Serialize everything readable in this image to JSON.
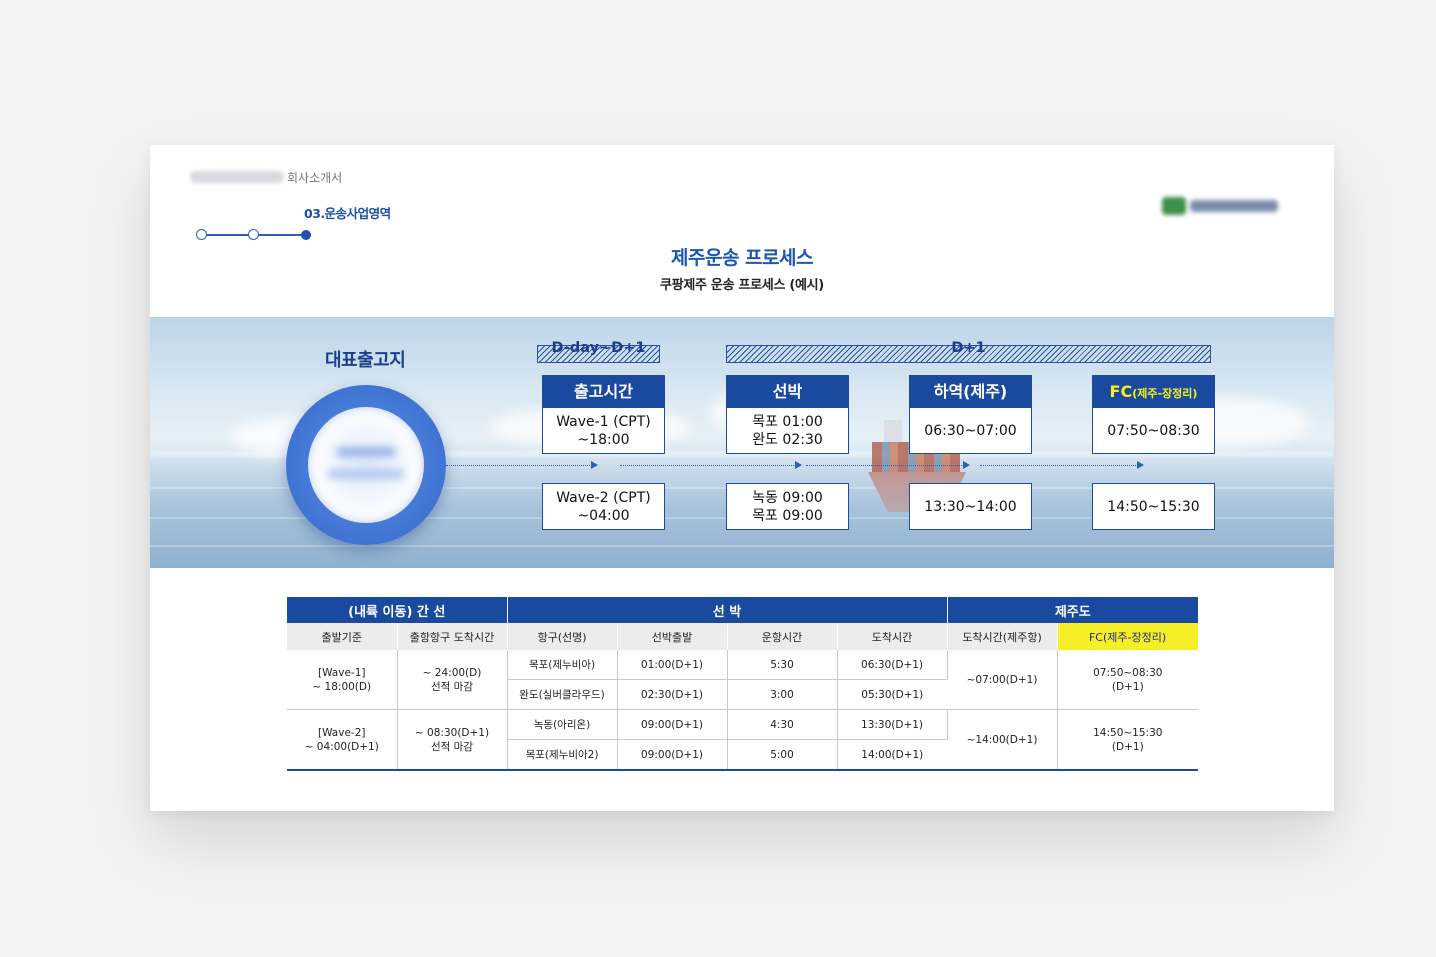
{
  "header": {
    "doc_title": "회사소개서",
    "section_label": "03.운송사업영역",
    "main_title": "제주운송 프로세스",
    "sub_title": "쿠팡제주 운송 프로세스 (예시)"
  },
  "diagram": {
    "depot_label": "대표출고지",
    "periods": [
      "D-day~D+1",
      "D+1"
    ],
    "stages": [
      {
        "title": "출고시간",
        "top_lines": [
          "Wave-1 (CPT)",
          "~18:00"
        ],
        "bottom_lines": [
          "Wave-2 (CPT)",
          "~04:00"
        ]
      },
      {
        "title": "선박",
        "top_lines": [
          "목포 01:00",
          "완도 02:30"
        ],
        "bottom_lines": [
          "녹동 09:00",
          "목포 09:00"
        ]
      },
      {
        "title": "하역(제주)",
        "top_lines": [
          "06:30~07:00"
        ],
        "bottom_lines": [
          "13:30~14:00"
        ]
      },
      {
        "title_main": "FC",
        "title_sub": "(제주-장정리)",
        "top_lines": [
          "07:50~08:30"
        ],
        "bottom_lines": [
          "14:50~15:30"
        ]
      }
    ]
  },
  "table": {
    "groups": [
      "(내륙 이동) 간 선",
      "선 박",
      "제주도"
    ],
    "headers": [
      "출발기준",
      "출항항구 도착시간",
      "항구(선명)",
      "선박출발",
      "운항시간",
      "도착시간",
      "도착시간(제주항)",
      "FC(제주-장정리)"
    ],
    "wave1": {
      "start": [
        "[Wave-1]",
        "~ 18:00(D)"
      ],
      "port_arrival": [
        "~ 24:00(D)",
        "선적 마감"
      ],
      "ships": [
        {
          "port": "목포(제누비아)",
          "depart": "01:00(D+1)",
          "duration": "5:30",
          "arrive": "06:30(D+1)"
        },
        {
          "port": "완도(실버클라우드)",
          "depart": "02:30(D+1)",
          "duration": "3:00",
          "arrive": "05:30(D+1)"
        }
      ],
      "jeju_arrival": "~07:00(D+1)",
      "fc": [
        "07:50~08:30",
        "(D+1)"
      ]
    },
    "wave2": {
      "start": [
        "[Wave-2]",
        "~ 04:00(D+1)"
      ],
      "port_arrival": [
        "~ 08:30(D+1)",
        "선적 마감"
      ],
      "ships": [
        {
          "port": "녹동(아리온)",
          "depart": "09:00(D+1)",
          "duration": "4:30",
          "arrive": "13:30(D+1)"
        },
        {
          "port": "목포(제누비아2)",
          "depart": "09:00(D+1)",
          "duration": "5:00",
          "arrive": "14:00(D+1)"
        }
      ],
      "jeju_arrival": "~14:00(D+1)",
      "fc": [
        "14:50~15:30",
        "(D+1)"
      ]
    }
  },
  "colors": {
    "primary": "#1a4aa0",
    "title_blue": "#1b56b5",
    "highlight": "#f6ef27"
  }
}
